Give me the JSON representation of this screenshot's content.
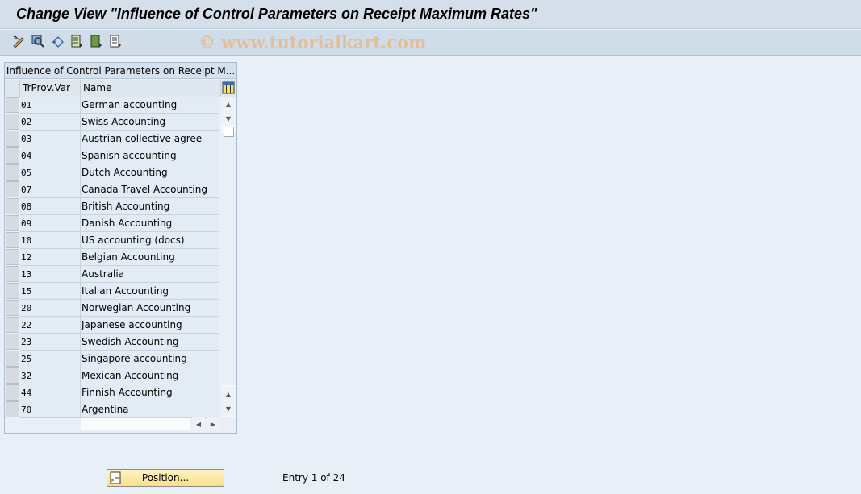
{
  "window": {
    "title": "Change View \"Influence of Control Parameters on Receipt Maximum Rates\""
  },
  "toolbar": {
    "icons": [
      "display-change-icon",
      "find-icon",
      "undo-icon",
      "select-all-icon",
      "select-block-icon",
      "deselect-all-icon"
    ],
    "watermark": "© www.tutorialkart.com"
  },
  "table": {
    "title": "Influence of Control Parameters on Receipt M...",
    "columns": [
      "TrProv.Var",
      "Name"
    ],
    "rows": [
      {
        "code": "01",
        "name": "German accounting"
      },
      {
        "code": "02",
        "name": "Swiss Accounting"
      },
      {
        "code": "03",
        "name": "Austrian collective agree"
      },
      {
        "code": "04",
        "name": "Spanish accounting"
      },
      {
        "code": "05",
        "name": "Dutch Accounting"
      },
      {
        "code": "07",
        "name": "Canada Travel Accounting"
      },
      {
        "code": "08",
        "name": "British Accounting"
      },
      {
        "code": "09",
        "name": "Danish Accounting"
      },
      {
        "code": "10",
        "name": "US accounting (docs)"
      },
      {
        "code": "12",
        "name": "Belgian Accounting"
      },
      {
        "code": "13",
        "name": "Australia"
      },
      {
        "code": "15",
        "name": "Italian Accounting"
      },
      {
        "code": "20",
        "name": "Norwegian Accounting"
      },
      {
        "code": "22",
        "name": "Japanese accounting"
      },
      {
        "code": "23",
        "name": "Swedish Accounting"
      },
      {
        "code": "25",
        "name": "Singapore accounting"
      },
      {
        "code": "32",
        "name": "Mexican Accounting"
      },
      {
        "code": "44",
        "name": "Finnish Accounting"
      },
      {
        "code": "70",
        "name": "Argentina"
      }
    ]
  },
  "footer": {
    "position_button": "Position...",
    "entry_status": "Entry 1 of 24"
  }
}
